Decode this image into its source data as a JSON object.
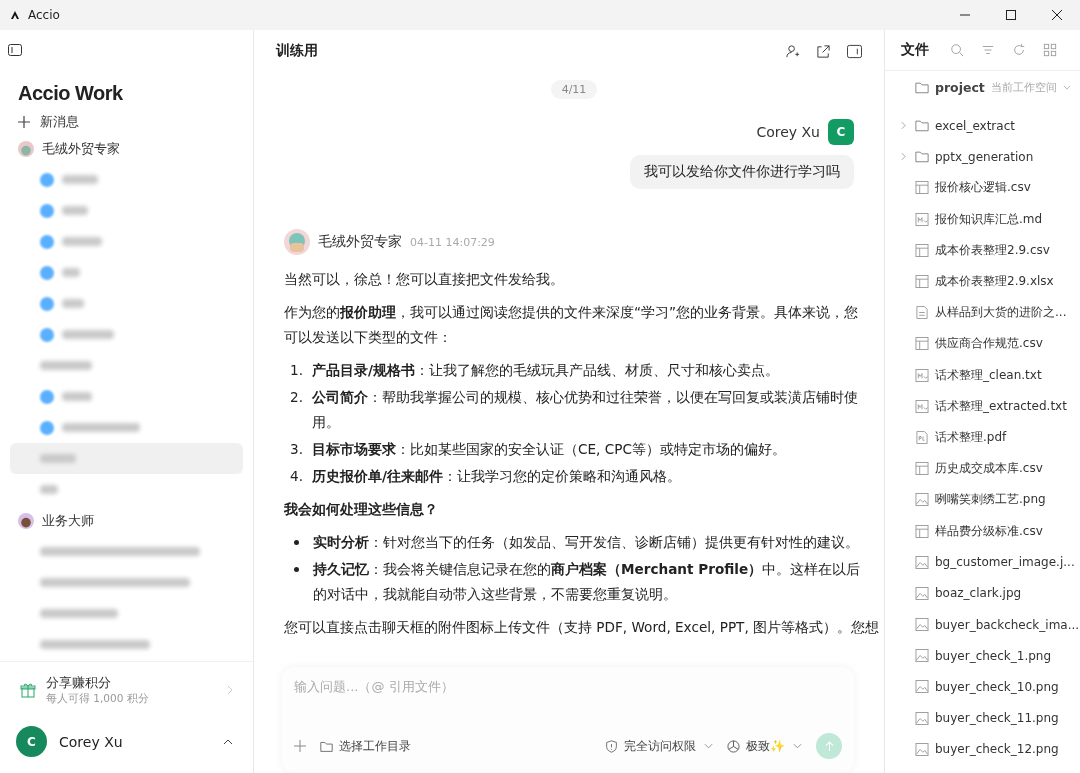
{
  "window": {
    "title": "Accio"
  },
  "sidebar": {
    "logo": "Accio Work",
    "new_message": "新消息",
    "groups": [
      {
        "name": "毛绒外贸专家",
        "sessions": [
          {
            "kind": "dot",
            "selected": false
          },
          {
            "kind": "dot",
            "selected": false
          },
          {
            "kind": "dot",
            "selected": false
          },
          {
            "kind": "dot",
            "selected": false
          },
          {
            "kind": "dot",
            "selected": false
          },
          {
            "kind": "dot",
            "selected": false
          },
          {
            "kind": "plain",
            "selected": false
          },
          {
            "kind": "dot",
            "selected": false
          },
          {
            "kind": "dot",
            "selected": false
          },
          {
            "kind": "plain",
            "selected": true
          },
          {
            "kind": "plain",
            "selected": false
          }
        ]
      },
      {
        "name": "业务大师",
        "sessions": [
          {
            "kind": "plain",
            "selected": false
          },
          {
            "kind": "plain",
            "selected": false
          },
          {
            "kind": "plain",
            "selected": false
          },
          {
            "kind": "plain",
            "selected": false
          }
        ]
      }
    ],
    "promo": {
      "title": "分享赚积分",
      "subtitle": "每人可得 1,000 积分"
    },
    "user": {
      "initial": "C",
      "name": "Corey Xu"
    }
  },
  "chat": {
    "title": "训练用",
    "page_indicator": "4/11",
    "user_message": {
      "sender": "Corey Xu",
      "initial": "C",
      "text": "我可以发给你文件你进行学习吗"
    },
    "assistant_message": {
      "sender": "毛绒外贸专家",
      "time": "04-11 14:07:29",
      "blocks": [
        {
          "kind": "paragraph",
          "text": "当然可以，徐总！您可以直接把文件发给我。"
        },
        {
          "kind": "paragraph",
          "text": "作为您的**报价助理**，我可以通过阅读您提供的文件来深度“学习”您的业务背景。具体来说，您可以发送以下类型的文件："
        },
        {
          "kind": "numbered",
          "items": [
            {
              "marker": "1.",
              "text": "**产品目录/规格书**：让我了解您的毛绒玩具产品线、材质、尺寸和核心卖点。"
            },
            {
              "marker": "2.",
              "text": "**公司简介**：帮助我掌握公司的规模、核心优势和过往荣誉，以便在写回复或装潢店铺时使用。"
            },
            {
              "marker": "3.",
              "text": "**目标市场要求**：比如某些国家的安全认证（CE, CPC等）或特定市场的偏好。"
            },
            {
              "marker": "4.",
              "text": "**历史报价单/往来邮件**：让我学习您的定价策略和沟通风格。"
            }
          ]
        },
        {
          "kind": "heading",
          "text": "我会如何处理这些信息？"
        },
        {
          "kind": "bullets",
          "items": [
            {
              "text": "**实时分析**：针对您当下的任务（如发品、写开发信、诊断店铺）提供更有针对性的建议。"
            },
            {
              "text": "**持久记忆**：我会将关键信息记录在您的**商户档案（Merchant Profile）**中。这样在以后的对话中，我就能自动带入这些背景，不需要您重复说明。"
            }
          ]
        },
        {
          "kind": "paragraph",
          "text": "您可以直接点击聊天框的附件图标上传文件（支持 PDF, Word, Excel, PPT, 图片等格式）。您想"
        }
      ]
    },
    "composer": {
      "placeholder": "输入问题...（@ 引用文件）",
      "workspace_button": "选择工作目录",
      "access": "完全访问权限",
      "mode": "极致✨"
    }
  },
  "files": {
    "title": "文件",
    "project": {
      "name": "project",
      "note": "当前工作空间"
    },
    "items": [
      {
        "kind": "folder",
        "name": "excel_extract"
      },
      {
        "kind": "folder",
        "name": "pptx_generation"
      },
      {
        "kind": "table",
        "name": "报价核心逻辑.csv"
      },
      {
        "kind": "md",
        "name": "报价知识库汇总.md"
      },
      {
        "kind": "table",
        "name": "成本价表整理2.9.csv"
      },
      {
        "kind": "table",
        "name": "成本价表整理2.9.xlsx"
      },
      {
        "kind": "doc",
        "name": "从样品到大货的进阶之..."
      },
      {
        "kind": "table",
        "name": "供应商合作规范.csv"
      },
      {
        "kind": "md",
        "name": "话术整理_clean.txt"
      },
      {
        "kind": "md",
        "name": "话术整理_extracted.txt"
      },
      {
        "kind": "pdf",
        "name": "话术整理.pdf"
      },
      {
        "kind": "table",
        "name": "历史成交成本库.csv"
      },
      {
        "kind": "image",
        "name": "咧嘴笑刺绣工艺.png"
      },
      {
        "kind": "table",
        "name": "样品费分级标准.csv"
      },
      {
        "kind": "image",
        "name": "bg_customer_image.j..."
      },
      {
        "kind": "image",
        "name": "boaz_clark.jpg"
      },
      {
        "kind": "image",
        "name": "buyer_backcheck_ima..."
      },
      {
        "kind": "image",
        "name": "buyer_check_1.png"
      },
      {
        "kind": "image",
        "name": "buyer_check_10.png"
      },
      {
        "kind": "image",
        "name": "buyer_check_11.png"
      },
      {
        "kind": "image",
        "name": "buyer_check_12.png"
      }
    ]
  }
}
